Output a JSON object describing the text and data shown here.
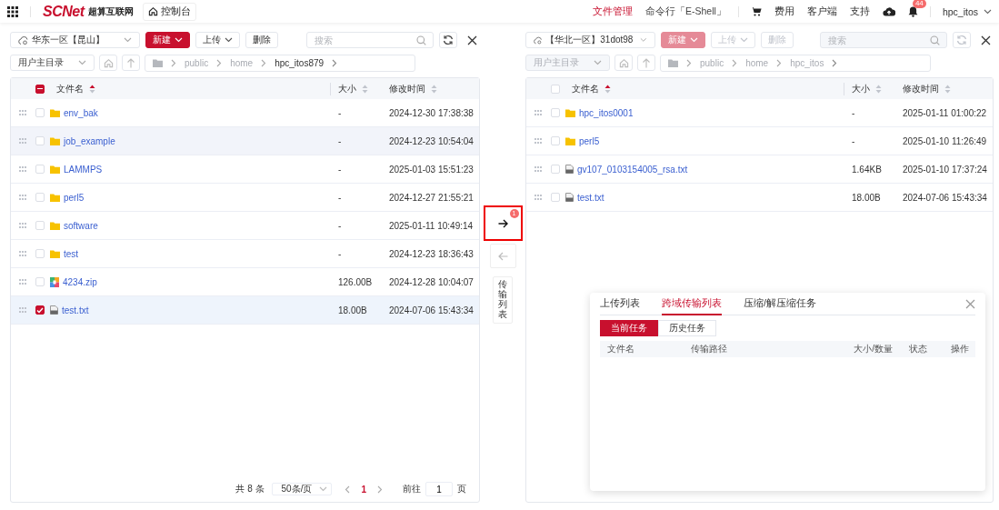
{
  "header": {
    "logo": "SCNet",
    "logo_sub": "超算互联网",
    "console": "控制台",
    "nav": [
      {
        "label": "文件管理",
        "selected": true
      },
      {
        "label": "命令行「E-Shell」",
        "selected": false
      }
    ],
    "links": [
      "费用",
      "客户端",
      "支持"
    ],
    "notification_count": "44",
    "user": "hpc_itos"
  },
  "panes": [
    {
      "region": "华东一区【昆山】",
      "disabled": false,
      "buttons": [
        {
          "label": "新建",
          "kind": "primary"
        },
        {
          "label": "上传",
          "kind": "dropdown"
        },
        {
          "label": "删除",
          "kind": "plain"
        }
      ],
      "search_placeholder": "搜索",
      "root": "用户主目录",
      "path": [
        "public",
        "home",
        "hpc_itos879"
      ],
      "columns": [
        "文件名",
        "大小",
        "修改时间"
      ],
      "partially_checked": true,
      "rows": [
        {
          "name": "env_bak",
          "kind": "folder",
          "size": "-",
          "modified": "2024-12-30 17:38:38",
          "checked": false,
          "hovered": false
        },
        {
          "name": "job_example",
          "kind": "folder",
          "size": "-",
          "modified": "2024-12-23 10:54:04",
          "checked": false,
          "hovered": true
        },
        {
          "name": "LAMMPS",
          "kind": "folder",
          "size": "-",
          "modified": "2025-01-03 15:51:23",
          "checked": false,
          "hovered": false
        },
        {
          "name": "perl5",
          "kind": "folder",
          "size": "-",
          "modified": "2024-12-27 21:55:21",
          "checked": false,
          "hovered": false
        },
        {
          "name": "software",
          "kind": "folder",
          "size": "-",
          "modified": "2025-01-11 10:49:14",
          "checked": false,
          "hovered": false
        },
        {
          "name": "test",
          "kind": "folder",
          "size": "-",
          "modified": "2024-12-23 18:36:43",
          "checked": false,
          "hovered": false
        },
        {
          "name": "4234.zip",
          "kind": "zip",
          "size": "126.00B",
          "modified": "2024-12-28 10:04:07",
          "checked": false,
          "hovered": false
        },
        {
          "name": "test.txt",
          "kind": "file",
          "size": "18.00B",
          "modified": "2024-07-06 15:43:34",
          "checked": true,
          "hovered": false
        }
      ],
      "pagination": {
        "total": "共 8 条",
        "page_size": "50条/页",
        "current": "1",
        "goto_label": "前往",
        "goto_value": "1",
        "goto_suffix": "页"
      }
    },
    {
      "region": "【华北一区】31dot98",
      "disabled": true,
      "buttons": [
        {
          "label": "新建",
          "kind": "primary"
        },
        {
          "label": "上传",
          "kind": "dropdown"
        },
        {
          "label": "删除",
          "kind": "plain"
        }
      ],
      "search_placeholder": "搜索",
      "root": "用户主目录",
      "path": [
        "public",
        "home",
        "hpc_itos"
      ],
      "columns": [
        "文件名",
        "大小",
        "修改时间"
      ],
      "partially_checked": false,
      "rows": [
        {
          "name": "hpc_itos0001",
          "kind": "folder",
          "size": "-",
          "modified": "2025-01-11 01:00:22",
          "checked": false,
          "hovered": false
        },
        {
          "name": "perl5",
          "kind": "folder",
          "size": "-",
          "modified": "2025-01-10 11:26:49",
          "checked": false,
          "hovered": false
        },
        {
          "name": "gv107_0103154005_rsa.txt",
          "kind": "file",
          "size": "1.64KB",
          "modified": "2025-01-10 17:37:24",
          "checked": false,
          "hovered": false
        },
        {
          "name": "test.txt",
          "kind": "file",
          "size": "18.00B",
          "modified": "2024-07-06 15:43:34",
          "checked": false,
          "hovered": false
        }
      ]
    }
  ],
  "transfer": {
    "to_right": {
      "badge": "1",
      "highlighted": true,
      "disabled": false
    },
    "to_left": {
      "disabled": true
    },
    "list_button": "传输列表"
  },
  "popup": {
    "tabs": [
      {
        "label": "上传列表",
        "selected": false
      },
      {
        "label": "跨域传输列表",
        "selected": true
      },
      {
        "label": "压缩/解压缩任务",
        "selected": false
      }
    ],
    "subtabs": [
      {
        "label": "当前任务",
        "selected": true
      },
      {
        "label": "历史任务",
        "selected": false
      }
    ],
    "columns": [
      "文件名",
      "传输路径",
      "大小/数量",
      "状态",
      "操作"
    ]
  }
}
